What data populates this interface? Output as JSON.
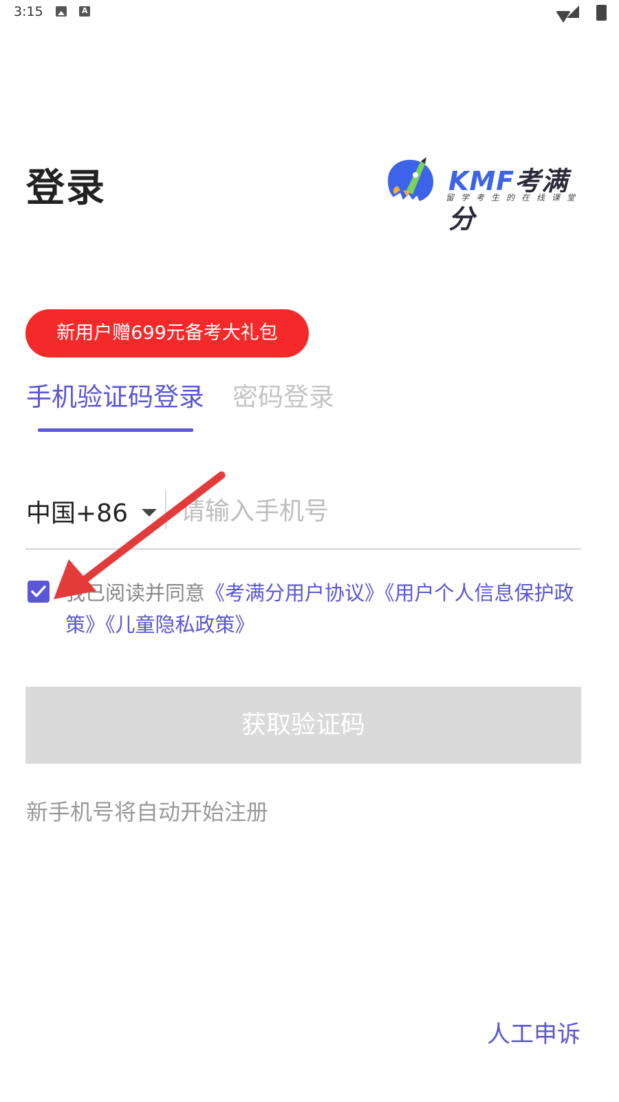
{
  "status_bar": {
    "time": "3:15"
  },
  "header": {
    "title": "登录",
    "logo": {
      "wordmark_latin": "KMF",
      "wordmark_cn": "考满分",
      "tagline": "留学考生的在线课堂"
    }
  },
  "promo": {
    "label": "新用户赠699元备考大礼包",
    "color": "#f42a2a"
  },
  "tabs": [
    {
      "label": "手机验证码登录",
      "active": true
    },
    {
      "label": "密码登录",
      "active": false
    }
  ],
  "phone": {
    "country_code": "中国+86",
    "placeholder": "请输入手机号",
    "value": ""
  },
  "agreement": {
    "checked": true,
    "prefix": "我已阅读并同意",
    "links": [
      "《考满分用户协议》",
      "《用户个人信息保护政策》",
      "《儿童隐私政策》"
    ]
  },
  "actions": {
    "get_code_label": "获取验证码",
    "hint": "新手机号将自动开始注册",
    "appeal_label": "人工申诉"
  },
  "colors": {
    "accent": "#5a56d6",
    "disabled_button": "#dadada",
    "annotation_arrow": "#e33a3a"
  },
  "icons": {
    "dropdown": "caret-down-icon",
    "checkbox": "checkmark-icon",
    "annotation": "red-arrow-icon"
  }
}
